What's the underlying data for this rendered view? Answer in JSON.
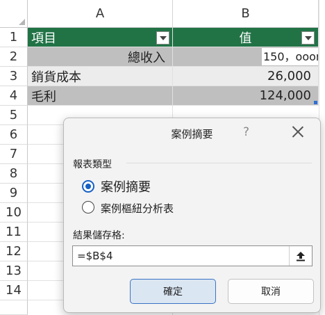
{
  "columns": [
    "A",
    "B"
  ],
  "rows": [
    "1",
    "2",
    "3",
    "4",
    "5",
    "6",
    "7",
    "8",
    "9",
    "10",
    "11",
    "12",
    "13",
    "14"
  ],
  "sheet": {
    "header": {
      "a": "項目",
      "b": "值"
    },
    "row2": {
      "a": "總收入",
      "b": "150，ooon"
    },
    "row3": {
      "a": "銷貨成本",
      "b": "26,000"
    },
    "row4": {
      "a": "毛利",
      "b": "124,000"
    }
  },
  "dialog": {
    "title": "案例摘要",
    "help": "?",
    "report_type_label": "報表類型",
    "option_case_summary": "案例摘要",
    "option_pivot_table": "案例樞紐分析表",
    "result_cell_label": "結果儲存格:",
    "result_cell_value": "=$B$4",
    "ok_label": "確定",
    "cancel_label": "取消",
    "selected_option": "案例摘要"
  },
  "colors": {
    "header_green": "#217346",
    "accent_blue": "#1560c4",
    "gray_row": "#bfbfbf"
  }
}
